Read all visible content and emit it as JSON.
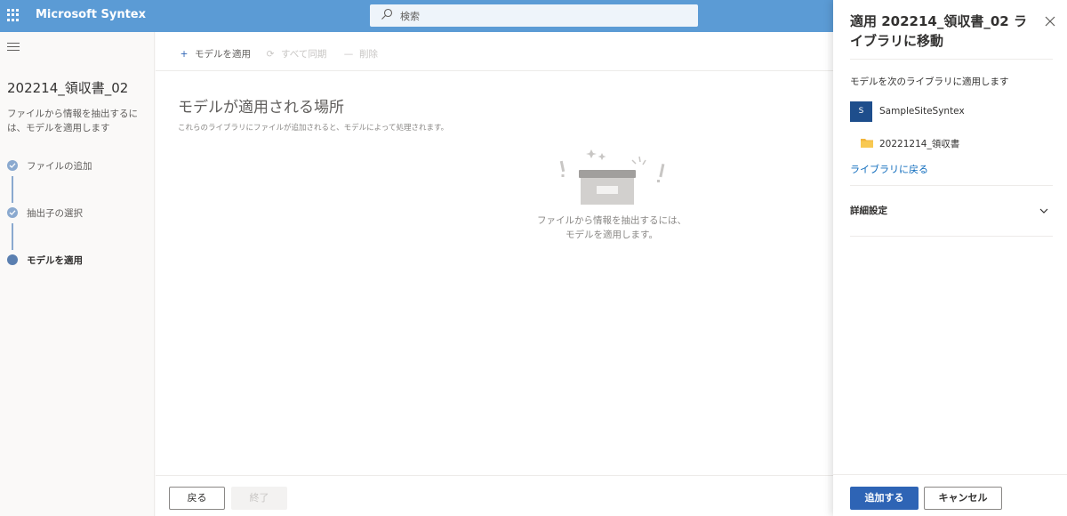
{
  "app": {
    "title": "Microsoft Syntex"
  },
  "search": {
    "placeholder": "検索"
  },
  "wizard": {
    "title": "202214_領収書_02",
    "description": "ファイルから情報を抽出するには、モデルを適用します",
    "steps": [
      {
        "label": "ファイルの追加",
        "state": "done"
      },
      {
        "label": "抽出子の選択",
        "state": "done"
      },
      {
        "label": "モデルを適用",
        "state": "current"
      }
    ]
  },
  "commands": {
    "apply_label": "モデルを適用",
    "sync_label": "すべて同期",
    "delete_label": "削除"
  },
  "main": {
    "heading": "モデルが適用される場所",
    "subtext": "これらのライブラリにファイルが追加されると、モデルによって処理されます。",
    "empty_line1": "ファイルから情報を抽出するには、",
    "empty_line2": "モデルを適用します。"
  },
  "footer": {
    "back_label": "戻る",
    "finish_label": "終了"
  },
  "panel": {
    "title": "適用 202214_領収書_02 ライブラリに移動",
    "apply_to_label": "モデルを次のライブラリに適用します",
    "site_badge": "S",
    "site_name": "SampleSiteSyntex",
    "library_name": "20221214_領収書",
    "back_link": "ライブラリに戻る",
    "advanced_label": "詳細設定",
    "add_label": "追加する",
    "cancel_label": "キャンセル"
  },
  "colors": {
    "topbar": "#5b9bd5",
    "primary_button": "#2e64b5",
    "link": "#0f6cbd",
    "step_dot": "#8aa9cf",
    "site_badge": "#1e4e8c"
  },
  "icons": [
    "waffle-icon",
    "search-icon",
    "hamburger-icon",
    "check-icon",
    "plus-icon",
    "sync-icon",
    "minus-icon",
    "empty-box-illustration",
    "close-icon",
    "folder-icon",
    "chevron-down-icon"
  ]
}
